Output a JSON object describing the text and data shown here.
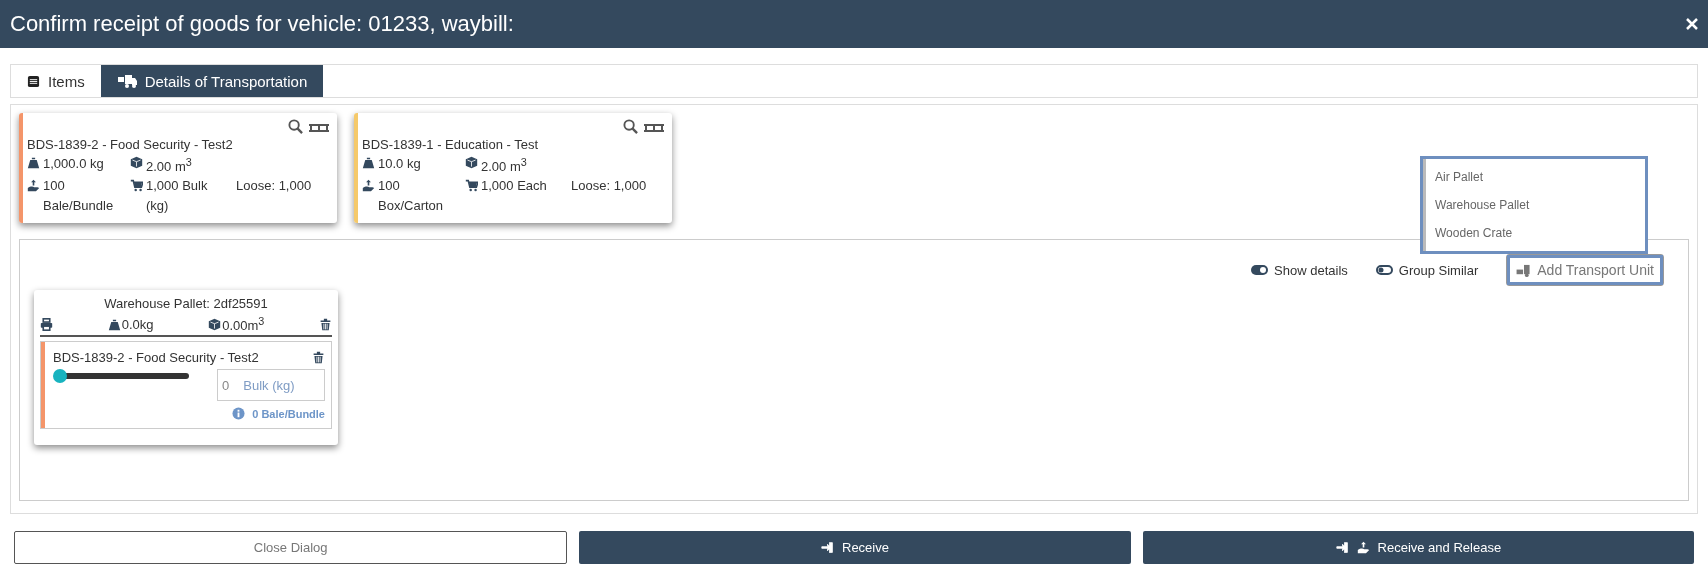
{
  "window": {
    "title": "Confirm receipt of goods for vehicle: 01233, waybill:"
  },
  "tabs": [
    {
      "label": "Items",
      "selected": false
    },
    {
      "label": "Details of Transportation",
      "selected": true
    }
  ],
  "item_cards": [
    {
      "title": "BDS-1839-2 - Food Security - Test2",
      "color": "#f4956a",
      "weight": "1,000.0 kg",
      "volume": "2.00 m$^{3}$",
      "quantity": "100 Bale/Bundle",
      "units": "1,000 Bulk (kg)",
      "loose": "Loose: 1,000"
    },
    {
      "title": "BDS-1839-1 - Education - Test",
      "color": "#f5c96a",
      "weight": "10.0 kg",
      "volume": "2.00 m$^{3}$",
      "quantity": "100 Box/Carton",
      "units": "1,000 Each",
      "loose": "Loose: 1,000"
    }
  ],
  "toggles": [
    {
      "label": "Show details",
      "on": true
    },
    {
      "label": "Group Similar",
      "on": false
    }
  ],
  "add_button": {
    "label": "Add Transport Unit"
  },
  "dropdown": {
    "items": [
      "Air Pallet",
      "Warehouse Pallet",
      "Wooden Crate"
    ]
  },
  "transport_units": [
    {
      "title": "Warehouse Pallet: 2df25591",
      "weight": "0.0kg",
      "volume": "0.00m$^{3}$",
      "items": [
        {
          "title": "BDS-1839-2 - Food Security - Test2",
          "color": "#f4956a",
          "level": 0,
          "value": "0",
          "unit": "Bulk (kg)",
          "note": "0 Bale/Bundle"
        }
      ]
    }
  ],
  "buttons": [
    {
      "label": "Close Dialog",
      "kind": "plain"
    },
    {
      "label": "Receive",
      "kind": "receive"
    },
    {
      "label": "Receive and Release",
      "kind": "release"
    }
  ]
}
